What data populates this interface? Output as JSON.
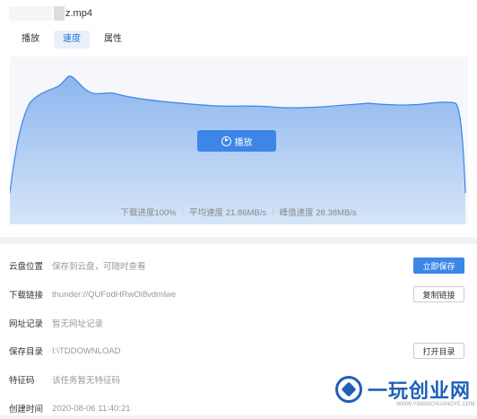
{
  "file": {
    "name_suffix": "z.mp4"
  },
  "tabs": [
    {
      "label": "播放",
      "active": false
    },
    {
      "label": "速度",
      "active": true
    },
    {
      "label": "属性",
      "active": false
    }
  ],
  "speed_chart": {
    "fill_color": "#a9c8f3",
    "line_color": "#3d86e8",
    "play_label": "播放"
  },
  "stats": {
    "progress": "下载进度100%",
    "avg_speed": "平均速度 21.86MB/s",
    "peak_speed": "峰值速度 28.38MB/s"
  },
  "info": {
    "cloud": {
      "label": "云盘位置",
      "value": "保存到云盘，可随时查看",
      "button": "立即保存"
    },
    "link": {
      "label": "下载链接",
      "value": "thunder://QUFodHRwOi8vdmlwe",
      "button": "复制链接"
    },
    "web": {
      "label": "网址记录",
      "value": "暂无网址记录"
    },
    "dir": {
      "label": "保存目录",
      "value": "I:\\TDDOWNLOAD",
      "button": "打开目录"
    },
    "hash": {
      "label": "特征码",
      "value": "该任务暂无特征码"
    },
    "created": {
      "label": "创建时间",
      "value": "2020-08-06 11:40:21"
    }
  },
  "watermark": {
    "text": "一玩创业网",
    "sub": "WWW.YIWANCHUANGYE.COM"
  }
}
